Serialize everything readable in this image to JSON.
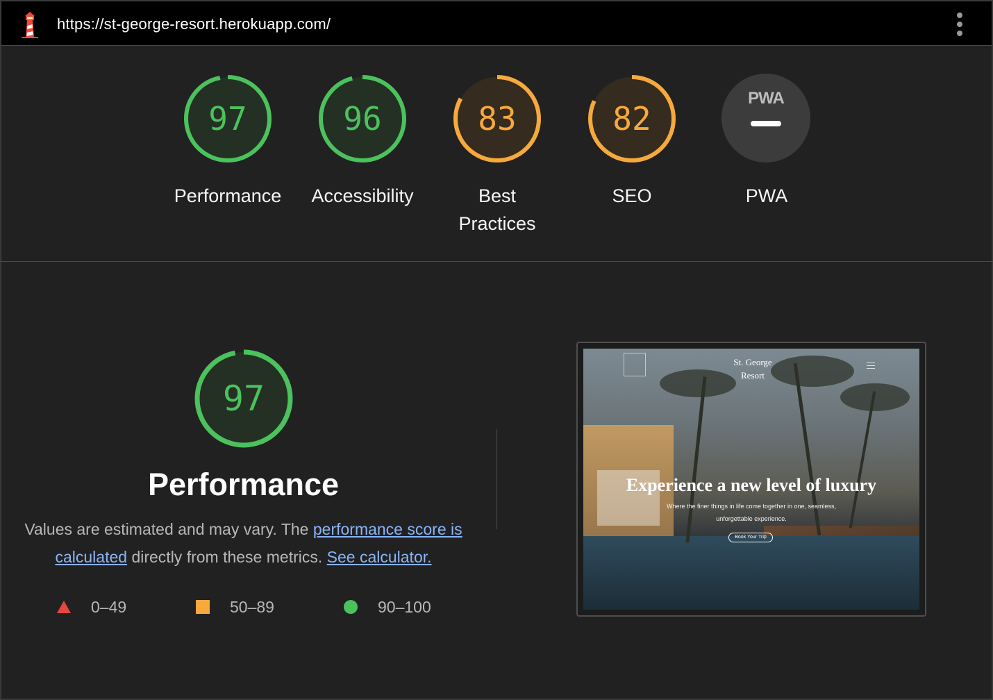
{
  "topbar": {
    "url": "https://st-george-resort.herokuapp.com/",
    "logo_icon": "lighthouse-icon",
    "menu_icon": "kebab-menu-icon"
  },
  "gauges": [
    {
      "id": "performance",
      "score": "97",
      "label": "Performance",
      "value": 97,
      "status": "pass"
    },
    {
      "id": "accessibility",
      "score": "96",
      "label": "Accessibility",
      "value": 96,
      "status": "pass"
    },
    {
      "id": "best-practices",
      "score": "83",
      "label": "Best Practices",
      "value": 83,
      "status": "average"
    },
    {
      "id": "seo",
      "score": "82",
      "label": "SEO",
      "value": 82,
      "status": "average"
    },
    {
      "id": "pwa",
      "badge_text": "PWA",
      "label": "PWA"
    }
  ],
  "performance": {
    "score": "97",
    "value": 97,
    "title": "Performance",
    "desc_prefix": "Values are estimated and may vary. The ",
    "score_link": "performance score is calculated",
    "desc_middle": " directly from these metrics. ",
    "calculator_link": "See calculator."
  },
  "legend": [
    {
      "range": "0–49",
      "shape": "triangle"
    },
    {
      "range": "50–89",
      "shape": "square"
    },
    {
      "range": "90–100",
      "shape": "circle"
    }
  ],
  "screenshot": {
    "brand": "St. George Resort",
    "brand_line1": "St. George",
    "brand_line2": "Resort",
    "headline": "Experience a new level of luxury",
    "subtext": "Where the finer things in life come together in one, seamless, unforgettable experience.",
    "cta": "Book Your Trip"
  },
  "colors": {
    "pass": "#4bc25d",
    "average": "#f6a93c",
    "fail": "#e8473f",
    "background": "#212121",
    "link": "#8ab4f8"
  }
}
